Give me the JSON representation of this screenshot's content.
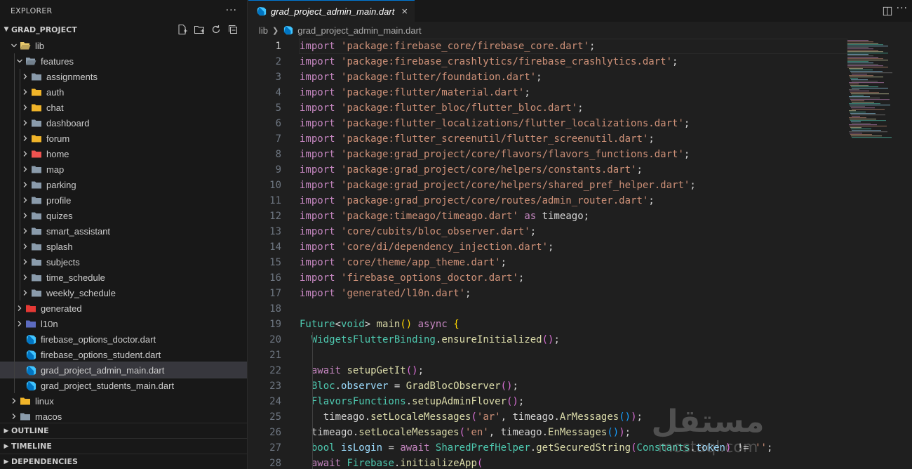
{
  "sidebar": {
    "title": "EXPLORER",
    "more_label": "···",
    "project": "GRAD_PROJECT",
    "tree": [
      {
        "label": "lib",
        "depth": 0,
        "kind": "folder",
        "open": true,
        "icon": "lib-folder-icon",
        "color": "#e8c96b"
      },
      {
        "label": "features",
        "depth": 1,
        "kind": "folder",
        "open": true,
        "icon": "folder-icon",
        "color": "#8a9bab"
      },
      {
        "label": "assignments",
        "depth": 2,
        "kind": "folder",
        "open": false,
        "icon": "folder-icon",
        "color": "#8a9bab"
      },
      {
        "label": "auth",
        "depth": 2,
        "kind": "folder",
        "open": false,
        "icon": "auth-folder-icon",
        "color": "#f0b429"
      },
      {
        "label": "chat",
        "depth": 2,
        "kind": "folder",
        "open": false,
        "icon": "chat-folder-icon",
        "color": "#f0b429"
      },
      {
        "label": "dashboard",
        "depth": 2,
        "kind": "folder",
        "open": false,
        "icon": "folder-icon",
        "color": "#8a9bab"
      },
      {
        "label": "forum",
        "depth": 2,
        "kind": "folder",
        "open": false,
        "icon": "forum-folder-icon",
        "color": "#f0b429"
      },
      {
        "label": "home",
        "depth": 2,
        "kind": "folder",
        "open": false,
        "icon": "home-folder-icon",
        "color": "#ef5350"
      },
      {
        "label": "map",
        "depth": 2,
        "kind": "folder",
        "open": false,
        "icon": "folder-icon",
        "color": "#8a9bab"
      },
      {
        "label": "parking",
        "depth": 2,
        "kind": "folder",
        "open": false,
        "icon": "folder-icon",
        "color": "#8a9bab"
      },
      {
        "label": "profile",
        "depth": 2,
        "kind": "folder",
        "open": false,
        "icon": "folder-icon",
        "color": "#8a9bab"
      },
      {
        "label": "quizes",
        "depth": 2,
        "kind": "folder",
        "open": false,
        "icon": "folder-icon",
        "color": "#8a9bab"
      },
      {
        "label": "smart_assistant",
        "depth": 2,
        "kind": "folder",
        "open": false,
        "icon": "folder-icon",
        "color": "#8a9bab"
      },
      {
        "label": "splash",
        "depth": 2,
        "kind": "folder",
        "open": false,
        "icon": "folder-icon",
        "color": "#8a9bab"
      },
      {
        "label": "subjects",
        "depth": 2,
        "kind": "folder",
        "open": false,
        "icon": "folder-icon",
        "color": "#8a9bab"
      },
      {
        "label": "time_schedule",
        "depth": 2,
        "kind": "folder",
        "open": false,
        "icon": "folder-icon",
        "color": "#8a9bab"
      },
      {
        "label": "weekly_schedule",
        "depth": 2,
        "kind": "folder",
        "open": false,
        "icon": "folder-icon",
        "color": "#8a9bab"
      },
      {
        "label": "generated",
        "depth": 1,
        "kind": "folder",
        "open": false,
        "icon": "generated-folder-icon",
        "color": "#e53935"
      },
      {
        "label": "l10n",
        "depth": 1,
        "kind": "folder",
        "open": false,
        "icon": "l10n-folder-icon",
        "color": "#5c6bc0"
      },
      {
        "label": "firebase_options_doctor.dart",
        "depth": 1,
        "kind": "file",
        "icon": "dart-file-icon"
      },
      {
        "label": "firebase_options_student.dart",
        "depth": 1,
        "kind": "file",
        "icon": "dart-file-icon"
      },
      {
        "label": "grad_project_admin_main.dart",
        "depth": 1,
        "kind": "file",
        "icon": "dart-file-icon",
        "selected": true
      },
      {
        "label": "grad_project_students_main.dart",
        "depth": 1,
        "kind": "file",
        "icon": "dart-file-icon"
      },
      {
        "label": "linux",
        "depth": 0,
        "kind": "folder",
        "open": false,
        "icon": "linux-folder-icon",
        "color": "#f0b429"
      },
      {
        "label": "macos",
        "depth": 0,
        "kind": "folder",
        "open": false,
        "icon": "macos-folder-icon",
        "color": "#8a9bab"
      }
    ],
    "sections": [
      "OUTLINE",
      "TIMELINE",
      "DEPENDENCIES"
    ]
  },
  "editor": {
    "tab_label": "grad_project_admin_main.dart",
    "tab_close": "×",
    "breadcrumb": [
      "lib",
      "grad_project_admin_main.dart"
    ],
    "current_line": 1,
    "lines": [
      {
        "n": "1",
        "tokens": [
          [
            "kw",
            "import"
          ],
          [
            "pn",
            " "
          ],
          [
            "st",
            "'package:firebase_core/firebase_core.dart'"
          ],
          [
            "pn",
            ";"
          ]
        ]
      },
      {
        "n": "2",
        "tokens": [
          [
            "kw",
            "import"
          ],
          [
            "pn",
            " "
          ],
          [
            "st",
            "'package:firebase_crashlytics/firebase_crashlytics.dart'"
          ],
          [
            "pn",
            ";"
          ]
        ]
      },
      {
        "n": "3",
        "tokens": [
          [
            "kw",
            "import"
          ],
          [
            "pn",
            " "
          ],
          [
            "st",
            "'package:flutter/foundation.dart'"
          ],
          [
            "pn",
            ";"
          ]
        ]
      },
      {
        "n": "4",
        "tokens": [
          [
            "kw",
            "import"
          ],
          [
            "pn",
            " "
          ],
          [
            "st",
            "'package:flutter/material.dart'"
          ],
          [
            "pn",
            ";"
          ]
        ]
      },
      {
        "n": "5",
        "tokens": [
          [
            "kw",
            "import"
          ],
          [
            "pn",
            " "
          ],
          [
            "st",
            "'package:flutter_bloc/flutter_bloc.dart'"
          ],
          [
            "pn",
            ";"
          ]
        ]
      },
      {
        "n": "6",
        "tokens": [
          [
            "kw",
            "import"
          ],
          [
            "pn",
            " "
          ],
          [
            "st",
            "'package:flutter_localizations/flutter_localizations.dart'"
          ],
          [
            "pn",
            ";"
          ]
        ]
      },
      {
        "n": "7",
        "tokens": [
          [
            "kw",
            "import"
          ],
          [
            "pn",
            " "
          ],
          [
            "st",
            "'package:flutter_screenutil/flutter_screenutil.dart'"
          ],
          [
            "pn",
            ";"
          ]
        ]
      },
      {
        "n": "8",
        "tokens": [
          [
            "kw",
            "import"
          ],
          [
            "pn",
            " "
          ],
          [
            "st",
            "'package:grad_project/core/flavors/flavors_functions.dart'"
          ],
          [
            "pn",
            ";"
          ]
        ]
      },
      {
        "n": "9",
        "tokens": [
          [
            "kw",
            "import"
          ],
          [
            "pn",
            " "
          ],
          [
            "st",
            "'package:grad_project/core/helpers/constants.dart'"
          ],
          [
            "pn",
            ";"
          ]
        ]
      },
      {
        "n": "10",
        "tokens": [
          [
            "kw",
            "import"
          ],
          [
            "pn",
            " "
          ],
          [
            "st",
            "'package:grad_project/core/helpers/shared_pref_helper.dart'"
          ],
          [
            "pn",
            ";"
          ]
        ]
      },
      {
        "n": "11",
        "tokens": [
          [
            "kw",
            "import"
          ],
          [
            "pn",
            " "
          ],
          [
            "st",
            "'package:grad_project/core/routes/admin_router.dart'"
          ],
          [
            "pn",
            ";"
          ]
        ]
      },
      {
        "n": "12",
        "tokens": [
          [
            "kw",
            "import"
          ],
          [
            "pn",
            " "
          ],
          [
            "st",
            "'package:timeago/timeago.dart'"
          ],
          [
            "pn",
            " "
          ],
          [
            "kw",
            "as"
          ],
          [
            "pn",
            " timeago;"
          ]
        ]
      },
      {
        "n": "13",
        "tokens": [
          [
            "kw",
            "import"
          ],
          [
            "pn",
            " "
          ],
          [
            "st",
            "'core/cubits/bloc_observer.dart'"
          ],
          [
            "pn",
            ";"
          ]
        ]
      },
      {
        "n": "14",
        "tokens": [
          [
            "kw",
            "import"
          ],
          [
            "pn",
            " "
          ],
          [
            "st",
            "'core/di/dependency_injection.dart'"
          ],
          [
            "pn",
            ";"
          ]
        ]
      },
      {
        "n": "15",
        "tokens": [
          [
            "kw",
            "import"
          ],
          [
            "pn",
            " "
          ],
          [
            "st",
            "'core/theme/app_theme.dart'"
          ],
          [
            "pn",
            ";"
          ]
        ]
      },
      {
        "n": "16",
        "tokens": [
          [
            "kw",
            "import"
          ],
          [
            "pn",
            " "
          ],
          [
            "st",
            "'firebase_options_doctor.dart'"
          ],
          [
            "pn",
            ";"
          ]
        ]
      },
      {
        "n": "17",
        "tokens": [
          [
            "kw",
            "import"
          ],
          [
            "pn",
            " "
          ],
          [
            "st",
            "'generated/l10n.dart'"
          ],
          [
            "pn",
            ";"
          ]
        ]
      },
      {
        "n": "18",
        "tokens": []
      },
      {
        "n": "19",
        "tokens": [
          [
            "ty",
            "Future"
          ],
          [
            "pn",
            "<"
          ],
          [
            "ty",
            "void"
          ],
          [
            "pn",
            "> "
          ],
          [
            "fn",
            "main"
          ],
          [
            "br1",
            "()"
          ],
          [
            "pn",
            " "
          ],
          [
            "kw",
            "async"
          ],
          [
            "pn",
            " "
          ],
          [
            "br1",
            "{"
          ]
        ]
      },
      {
        "n": "20",
        "tokens": [
          [
            "pn",
            "  "
          ],
          [
            "ty",
            "WidgetsFlutterBinding"
          ],
          [
            "pn",
            "."
          ],
          [
            "fn",
            "ensureInitialized"
          ],
          [
            "br2",
            "()"
          ],
          [
            "pn",
            ";"
          ]
        ]
      },
      {
        "n": "21",
        "tokens": []
      },
      {
        "n": "22",
        "tokens": [
          [
            "pn",
            "  "
          ],
          [
            "kw",
            "await"
          ],
          [
            "pn",
            " "
          ],
          [
            "fn",
            "setupGetIt"
          ],
          [
            "br2",
            "()"
          ],
          [
            "pn",
            ";"
          ]
        ]
      },
      {
        "n": "23",
        "tokens": [
          [
            "pn",
            "  "
          ],
          [
            "ty",
            "Bloc"
          ],
          [
            "pn",
            "."
          ],
          [
            "vr",
            "observer"
          ],
          [
            "pn",
            " = "
          ],
          [
            "fn",
            "GradBlocObserver"
          ],
          [
            "br2",
            "()"
          ],
          [
            "pn",
            ";"
          ]
        ]
      },
      {
        "n": "24",
        "tokens": [
          [
            "pn",
            "  "
          ],
          [
            "ty",
            "FlavorsFunctions"
          ],
          [
            "pn",
            "."
          ],
          [
            "fn",
            "setupAdminFlover"
          ],
          [
            "br2",
            "()"
          ],
          [
            "pn",
            ";"
          ]
        ]
      },
      {
        "n": "25",
        "tokens": [
          [
            "pn",
            "    timeago."
          ],
          [
            "fn",
            "setLocaleMessages"
          ],
          [
            "br2",
            "("
          ],
          [
            "st",
            "'ar'"
          ],
          [
            "pn",
            ", timeago."
          ],
          [
            "fn",
            "ArMessages"
          ],
          [
            "br3",
            "()"
          ],
          [
            "br2",
            ")"
          ],
          [
            "pn",
            ";"
          ]
        ]
      },
      {
        "n": "26",
        "tokens": [
          [
            "pn",
            "  timeago."
          ],
          [
            "fn",
            "setLocaleMessages"
          ],
          [
            "br2",
            "("
          ],
          [
            "st",
            "'en'"
          ],
          [
            "pn",
            ", timeago."
          ],
          [
            "fn",
            "EnMessages"
          ],
          [
            "br3",
            "()"
          ],
          [
            "br2",
            ")"
          ],
          [
            "pn",
            ";"
          ]
        ]
      },
      {
        "n": "27",
        "tokens": [
          [
            "pn",
            "  "
          ],
          [
            "ty",
            "bool"
          ],
          [
            "pn",
            " "
          ],
          [
            "vr",
            "isLogin"
          ],
          [
            "pn",
            " = "
          ],
          [
            "kw",
            "await"
          ],
          [
            "pn",
            " "
          ],
          [
            "ty",
            "SharedPrefHelper"
          ],
          [
            "pn",
            "."
          ],
          [
            "fn",
            "getSecuredString"
          ],
          [
            "br2",
            "("
          ],
          [
            "ty",
            "Constants"
          ],
          [
            "pn",
            "."
          ],
          [
            "vr",
            "token"
          ],
          [
            "br2",
            ")"
          ],
          [
            "pn",
            " != "
          ],
          [
            "st",
            "''"
          ],
          [
            "pn",
            ";"
          ]
        ]
      },
      {
        "n": "28",
        "tokens": [
          [
            "pn",
            "  "
          ],
          [
            "kw",
            "await"
          ],
          [
            "pn",
            " "
          ],
          [
            "ty",
            "Firebase"
          ],
          [
            "pn",
            "."
          ],
          [
            "fn",
            "initializeApp"
          ],
          [
            "br2",
            "("
          ]
        ]
      }
    ]
  },
  "watermark": {
    "arabic": "مستقل",
    "latin": "mostaql.com"
  }
}
